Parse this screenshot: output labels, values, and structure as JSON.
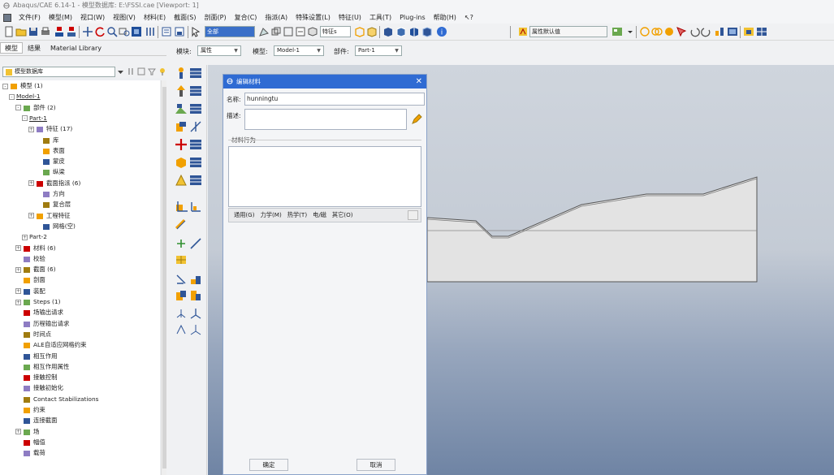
{
  "window": {
    "title": "Abaqus/CAE 6.14-1 - 模型数据库: E:\\FSSI.cae [Viewport: 1]"
  },
  "menu": [
    "文件(F)",
    "模型(M)",
    "视口(W)",
    "视图(V)",
    "材料(E)",
    "截面(S)",
    "剖面(P)",
    "复合(C)",
    "指派(A)",
    "特殊设置(L)",
    "特征(U)",
    "工具(T)",
    "Plug-ins",
    "帮助(H)",
    "↖?"
  ],
  "toolbar": {
    "filter_value": "全部",
    "filter2_value": "属性默认值"
  },
  "left_tabs": [
    "模型",
    "结果",
    "Material Library"
  ],
  "model_db": {
    "label": "模型数据库"
  },
  "module_bar": {
    "module_label": "模块:",
    "module_value": "属性",
    "model_label": "模型:",
    "model_value": "Model-1",
    "part_label": "部件:",
    "part_value": "Part-1"
  },
  "tree": [
    {
      "label": "模型 (1)",
      "level": 0,
      "exp": "-",
      "icon": "models-icon"
    },
    {
      "label": "Model-1",
      "level": 1,
      "exp": "-",
      "icon": "",
      "underline": true
    },
    {
      "label": "部件 (2)",
      "level": 2,
      "exp": "-",
      "icon": "parts-icon"
    },
    {
      "label": "Part-1",
      "level": 3,
      "exp": "-",
      "icon": "",
      "underline": true
    },
    {
      "label": "特征 (17)",
      "level": 4,
      "exp": "+",
      "icon": "features-icon"
    },
    {
      "label": "库",
      "level": 5,
      "exp": "",
      "icon": "datum-icon"
    },
    {
      "label": "表面",
      "level": 5,
      "exp": "",
      "icon": "surfaces-icon"
    },
    {
      "label": "蒙皮",
      "level": 5,
      "exp": "",
      "icon": "skins-icon"
    },
    {
      "label": "纵梁",
      "level": 5,
      "exp": "",
      "icon": "stringers-icon"
    },
    {
      "label": "截面指派 (6)",
      "level": 4,
      "exp": "+",
      "icon": "section-assign-icon"
    },
    {
      "label": "方向",
      "level": 5,
      "exp": "",
      "icon": "orientation-icon"
    },
    {
      "label": "复合层",
      "level": 5,
      "exp": "",
      "icon": "composite-icon"
    },
    {
      "label": "工程特征",
      "level": 4,
      "exp": "+",
      "icon": "eng-features-icon"
    },
    {
      "label": "网格(空)",
      "level": 5,
      "exp": "",
      "icon": "mesh-icon"
    },
    {
      "label": "Part-2",
      "level": 3,
      "exp": "+",
      "icon": ""
    },
    {
      "label": "材料 (6)",
      "level": 2,
      "exp": "+",
      "icon": "materials-icon"
    },
    {
      "label": "校验",
      "level": 2,
      "exp": "",
      "icon": "calibration-icon"
    },
    {
      "label": "截面 (6)",
      "level": 2,
      "exp": "+",
      "icon": "sections-icon"
    },
    {
      "label": "剖面",
      "level": 2,
      "exp": "",
      "icon": "profiles-icon"
    },
    {
      "label": "装配",
      "level": 2,
      "exp": "+",
      "icon": "assembly-icon"
    },
    {
      "label": "Steps (1)",
      "level": 2,
      "exp": "+",
      "icon": "steps-icon"
    },
    {
      "label": "场输出请求",
      "level": 2,
      "exp": "",
      "icon": "field-output-icon"
    },
    {
      "label": "历程输出请求",
      "level": 2,
      "exp": "",
      "icon": "history-output-icon"
    },
    {
      "label": "时间点",
      "level": 2,
      "exp": "",
      "icon": "time-points-icon"
    },
    {
      "label": "ALE自适应网格约束",
      "level": 2,
      "exp": "",
      "icon": "ale-icon"
    },
    {
      "label": "相互作用",
      "level": 2,
      "exp": "",
      "icon": "interactions-icon"
    },
    {
      "label": "相互作用属性",
      "level": 2,
      "exp": "",
      "icon": "interaction-props-icon"
    },
    {
      "label": "接触控制",
      "level": 2,
      "exp": "",
      "icon": "contact-controls-icon"
    },
    {
      "label": "接触初始化",
      "level": 2,
      "exp": "",
      "icon": "contact-init-icon"
    },
    {
      "label": "Contact Stabilizations",
      "level": 2,
      "exp": "",
      "icon": "contact-stab-icon"
    },
    {
      "label": "约束",
      "level": 2,
      "exp": "",
      "icon": "constraints-icon"
    },
    {
      "label": "连接截面",
      "level": 2,
      "exp": "",
      "icon": "connector-sections-icon"
    },
    {
      "label": "场",
      "level": 2,
      "exp": "+",
      "icon": "fields-icon"
    },
    {
      "label": "幅值",
      "level": 2,
      "exp": "",
      "icon": "amplitudes-icon"
    },
    {
      "label": "载荷",
      "level": 2,
      "exp": "",
      "icon": "loads-icon"
    }
  ],
  "dialog": {
    "title": "编辑材料",
    "name_label": "名称:",
    "name_value": "hunningtu",
    "desc_label": "描述:",
    "desc_value": "",
    "behavior_label": "材料行为",
    "menu": [
      "通用(G)",
      "力学(M)",
      "热学(T)",
      "电/磁",
      "其它(O)"
    ],
    "ok": "确定",
    "cancel": "取消"
  },
  "colors": {
    "accent": "#2f6bd3",
    "viewport_top": "#cfd5dd",
    "viewport_bottom": "#6f84a4",
    "part_fill": "#e3e3e3"
  }
}
